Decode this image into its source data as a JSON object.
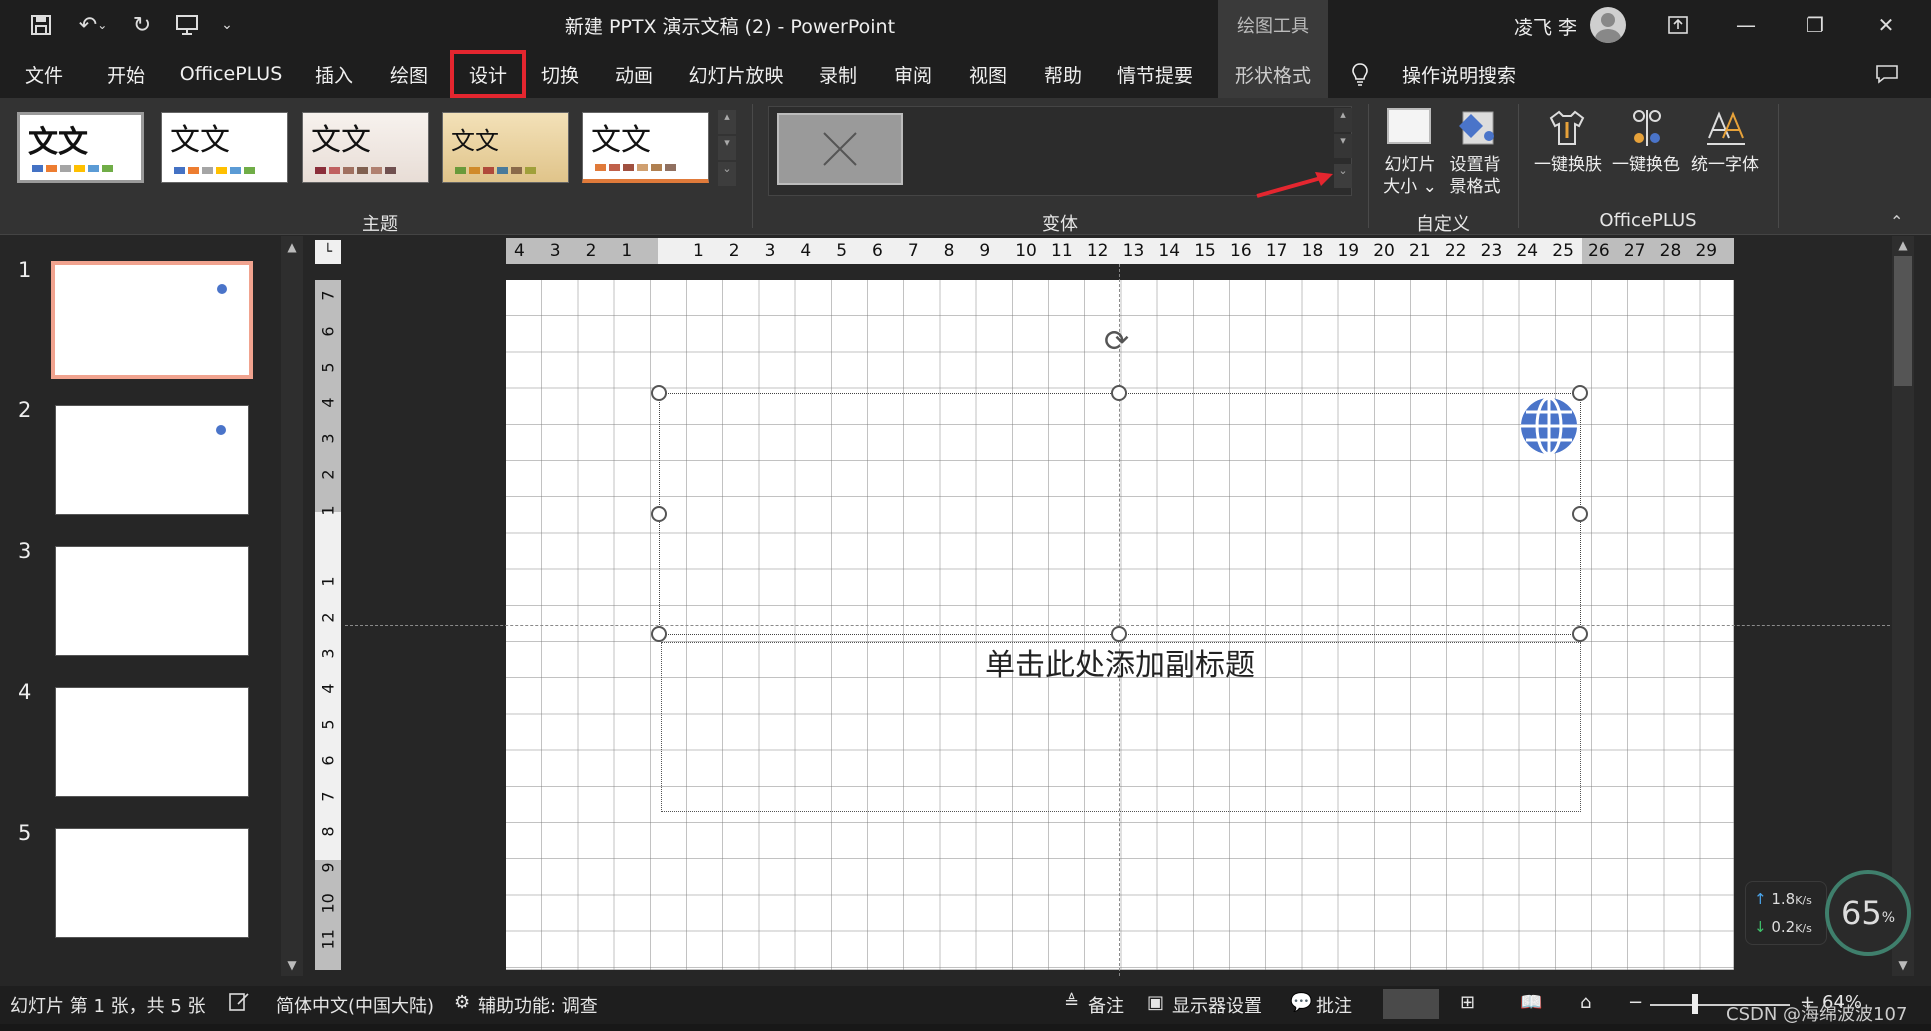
{
  "titlebar": {
    "title": "新建 PPTX 演示文稿 (2) - PowerPoint",
    "context_tab": "绘图工具",
    "user": "凌飞 李"
  },
  "menu": {
    "tabs": [
      "文件",
      "开始",
      "OfficePLUS",
      "插入",
      "绘图",
      "设计",
      "切换",
      "动画",
      "幻灯片放映",
      "录制",
      "审阅",
      "视图",
      "帮助",
      "情节提要",
      "形状格式"
    ],
    "tell_me": "操作说明搜索",
    "selected": "设计"
  },
  "ribbon": {
    "groups": {
      "themes": "主题",
      "variants": "变体",
      "customize": "自定义",
      "officeplus": "OfficePLUS"
    },
    "theme_text": "文文",
    "slide_size_l1": "幻灯片",
    "slide_size_l2": "大小 ⌄",
    "format_bg_l1": "设置背",
    "format_bg_l2": "景格式",
    "one_click_skin": "一键换肤",
    "one_click_color": "一键换色",
    "unify_font": "统一字体"
  },
  "slides": {
    "numbers": [
      "1",
      "2",
      "3",
      "4",
      "5"
    ]
  },
  "canvas": {
    "subtitle_placeholder": "单击此处添加副标题"
  },
  "rulers": {
    "h_ticks": [
      "4",
      "3",
      "2",
      "1",
      "",
      "1",
      "2",
      "3",
      "4",
      "5",
      "6",
      "7",
      "8",
      "9",
      "10",
      "11",
      "12",
      "13",
      "14",
      "15",
      "16",
      "17",
      "18",
      "19",
      "20",
      "21",
      "22",
      "23",
      "24",
      "25",
      "26",
      "27",
      "28",
      "29"
    ],
    "v_ticks": [
      "7",
      "6",
      "5",
      "4",
      "3",
      "2",
      "1",
      "",
      "1",
      "2",
      "3",
      "4",
      "5",
      "6",
      "7",
      "8",
      "9",
      "10",
      "11"
    ]
  },
  "status": {
    "slide_info": "幻灯片 第 1 张，共 5 张",
    "language": "简体中文(中国大陆)",
    "accessibility": "辅助功能: 调查",
    "notes": "备注",
    "display": "显示器设置",
    "comments": "批注",
    "zoom": "64%"
  },
  "overlay": {
    "up": "1.8",
    "down": "0.2",
    "unit": "K/s",
    "percent": "65",
    "percent_unit": "%",
    "watermark": "CSDN @海绵波波107"
  }
}
